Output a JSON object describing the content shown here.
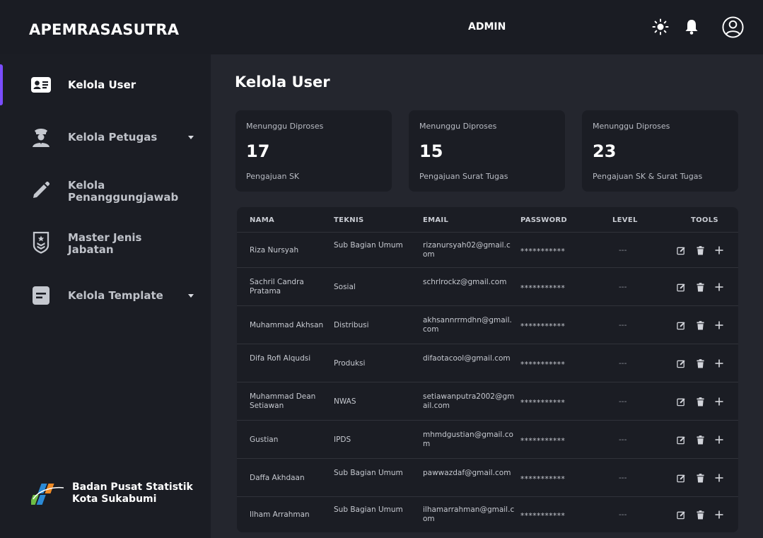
{
  "app": {
    "brand": "APEMRASASUTRA",
    "role": "ADMIN"
  },
  "header_icons": [
    "sun-icon",
    "bell-icon",
    "user-circle-icon"
  ],
  "sidebar": {
    "items": [
      {
        "label": "Kelola User",
        "icon": "id-card-icon",
        "active": true,
        "has_submenu": false
      },
      {
        "label": "Kelola Petugas",
        "icon": "officer-icon",
        "active": false,
        "has_submenu": true
      },
      {
        "label": "Kelola Penanggungjawab",
        "icon": "pencil-icon",
        "active": false,
        "has_submenu": false
      },
      {
        "label": "Master Jenis Jabatan",
        "icon": "badge-icon",
        "active": false,
        "has_submenu": false
      },
      {
        "label": "Kelola Template",
        "icon": "document-icon",
        "active": false,
        "has_submenu": true
      }
    ],
    "footer": {
      "line1": "Badan Pusat Statistik",
      "line2": "Kota Sukabumi"
    }
  },
  "main": {
    "title": "Kelola User",
    "cards": [
      {
        "label": "Menunggu Diproses",
        "value": "17",
        "sub": "Pengajuan SK"
      },
      {
        "label": "Menunggu Diproses",
        "value": "15",
        "sub": "Pengajuan Surat Tugas"
      },
      {
        "label": "Menunggu Diproses",
        "value": "23",
        "sub": "Pengajuan SK & Surat Tugas"
      }
    ],
    "table": {
      "headers": [
        "NAMA",
        "TEKNIS",
        "EMAIL",
        "PASSWORD",
        "LEVEL",
        "TOOLS"
      ],
      "rows": [
        {
          "nama": "Riza Nursyah",
          "teknis": "Sub Bagian Umum",
          "email": "rizanursyah02@gmail.com",
          "password": "***********",
          "level": "---"
        },
        {
          "nama": "Sachril Candra Pratama",
          "teknis": "Sosial",
          "email": "schrlrockz@gmail.com",
          "password": "***********",
          "level": "---"
        },
        {
          "nama": "Muhammad Akhsan",
          "teknis": "Distribusi",
          "email": "akhsannrrmdhn@gmail.com",
          "password": "***********",
          "level": "---"
        },
        {
          "nama": "Difa Rofi Alqudsi",
          "teknis": "Produksi",
          "email": "difaotacool@gmail.com",
          "password": "***********",
          "level": "---"
        },
        {
          "nama": "Muhammad Dean Setiawan",
          "teknis": "NWAS",
          "email": "setiawanputra2002@gmail.com",
          "password": "***********",
          "level": "---"
        },
        {
          "nama": "Gustian",
          "teknis": "IPDS",
          "email": "mhmdgustian@gmail.com",
          "password": "***********",
          "level": "---"
        },
        {
          "nama": "Daffa Akhdaan",
          "teknis": "Sub Bagian Umum",
          "email": "pawwazdaf@gmail.com",
          "password": "***********",
          "level": "---"
        },
        {
          "nama": "Ilham Arrahman",
          "teknis": "Sub Bagian Umum",
          "email": "ilhamarrahman@gmail.com",
          "password": "***********",
          "level": "---"
        }
      ],
      "tool_icons": [
        "edit-icon",
        "trash-icon",
        "plus-icon"
      ]
    }
  },
  "colors": {
    "accent": "#7b4dff",
    "sidebar_bg": "#1b1d24",
    "main_bg": "#24262e",
    "card_bg": "#1b1d24"
  }
}
